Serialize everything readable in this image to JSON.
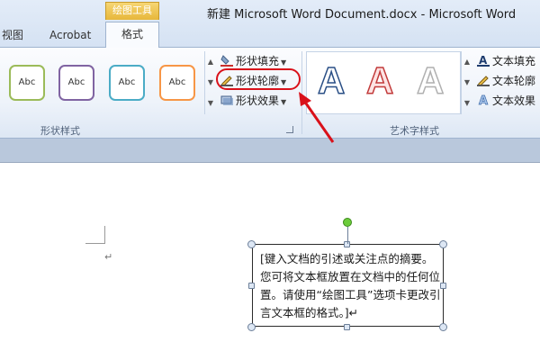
{
  "window": {
    "title": "新建 Microsoft Word Document.docx - Microsoft Word",
    "contextual_tab_group": "绘图工具"
  },
  "tabs": [
    {
      "label": "视图"
    },
    {
      "label": "Acrobat"
    },
    {
      "label": "格式",
      "active": true
    }
  ],
  "ribbon": {
    "shape_styles": {
      "group_label": "形状样式",
      "gallery": [
        {
          "label": "Abc",
          "color": "#9bbb59"
        },
        {
          "label": "Abc",
          "color": "#8064a2"
        },
        {
          "label": "Abc",
          "color": "#4bacc6"
        },
        {
          "label": "Abc",
          "color": "#f79646"
        }
      ],
      "commands": {
        "fill": "形状填充",
        "outline": "形状轮廓",
        "effect": "形状效果"
      }
    },
    "wordart_styles": {
      "group_label": "艺术字样式",
      "gallery": [
        {
          "label": "A",
          "color": "#2a4f86"
        },
        {
          "label": "A",
          "color": "#c23b3b"
        },
        {
          "label": "A",
          "color": "#b0b0b0"
        }
      ],
      "commands": {
        "fill": "文本填充",
        "outline": "文本轮廓",
        "effect": "文本效果"
      }
    }
  },
  "document": {
    "paragraph_mark": "↵",
    "textbox": {
      "text": "[键入文档的引述或关注点的摘要。您可将文本框放置在文档中的任何位置。请使用“绘图工具”选项卡更改引言文本框的格式。]↵"
    }
  },
  "annotation": {
    "highlight_color": "#d9111a"
  }
}
